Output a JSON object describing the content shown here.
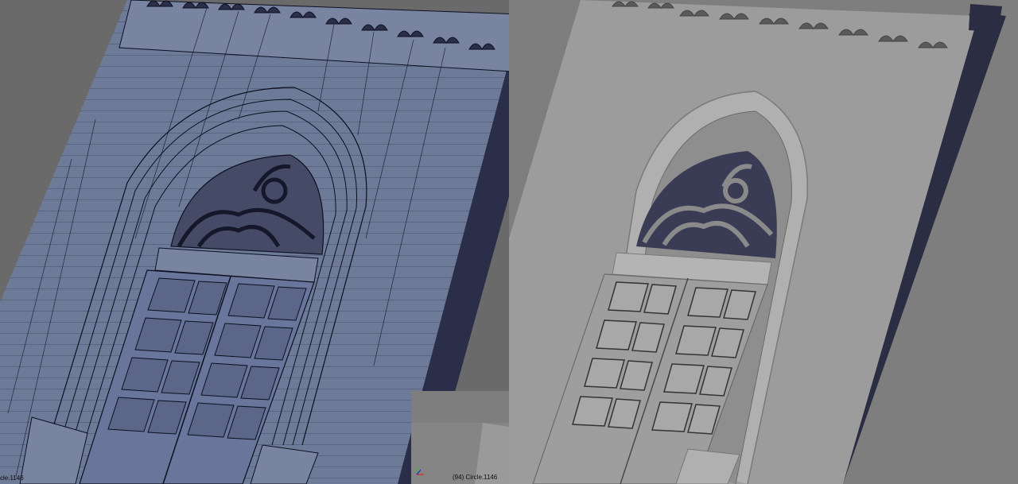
{
  "viewports": {
    "left": {
      "object_label": "cle.1146"
    },
    "inset": {
      "object_label": "(94) Circle.1146"
    }
  },
  "icons": {
    "axis": "axis-gizmo-icon"
  },
  "colors": {
    "wire_face": "#6d7a96",
    "wire_face_light": "#7a86a2",
    "wire_edge": "#0c1020",
    "wire_shadow": "#1e2238",
    "solid_face": "#9a9a9a",
    "solid_face_light": "#b2b2b2",
    "solid_shadow": "#2a2c40",
    "background": "#7e7e7e"
  }
}
